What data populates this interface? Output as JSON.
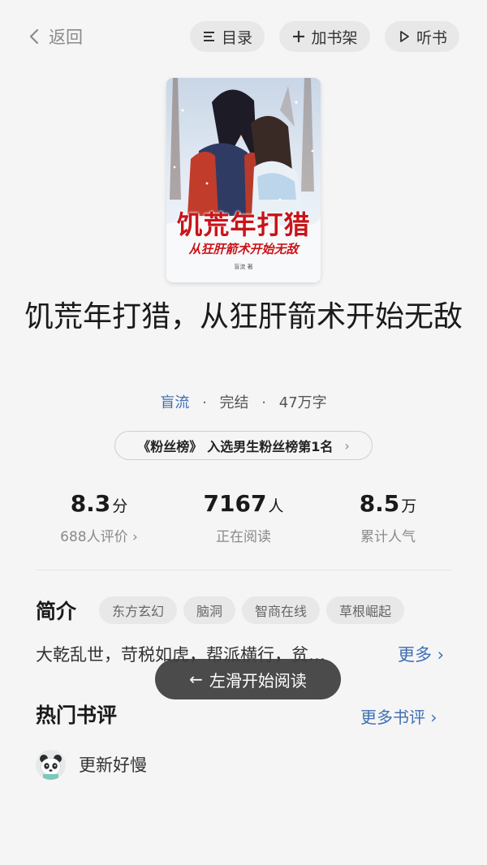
{
  "topbar": {
    "back_label": "返回",
    "toc_label": "目录",
    "shelf_label": "加书架",
    "listen_label": "听书"
  },
  "cover": {
    "title_text": "饥荒年打猎",
    "subtitle_text": "从狂肝箭术开始无敌",
    "author_text": "盲流 著"
  },
  "book": {
    "title": "饥荒年打猎，从狂肝箭术开始无敌",
    "author": "盲流",
    "status": "完结",
    "word_count": "47万字"
  },
  "rank": {
    "tag": "《粉丝榜》",
    "text": "入选男生粉丝榜第1名"
  },
  "stats": [
    {
      "value": "8.3",
      "unit": "分",
      "label": "688人评价 ›"
    },
    {
      "value": "7167",
      "unit": "人",
      "label": "正在阅读"
    },
    {
      "value": "8.5",
      "unit": "万",
      "label": "累计人气"
    }
  ],
  "intro": {
    "heading": "简介",
    "tags": [
      "东方玄幻",
      "脑洞",
      "智商在线",
      "草根崛起"
    ],
    "text": "大乾乱世，苛税如虎，帮派横行，贫…",
    "more_label": "更多 ›"
  },
  "toast": {
    "text": "左滑开始阅读",
    "arrow": "←"
  },
  "reviews": {
    "heading": "热门书评",
    "more_label": "更多书评 ›",
    "first_text": "更新好慢"
  },
  "colors": {
    "accent_blue": "#3e6fb3",
    "cover_red": "#c8141a",
    "page_bg": "#f5f5f5"
  }
}
